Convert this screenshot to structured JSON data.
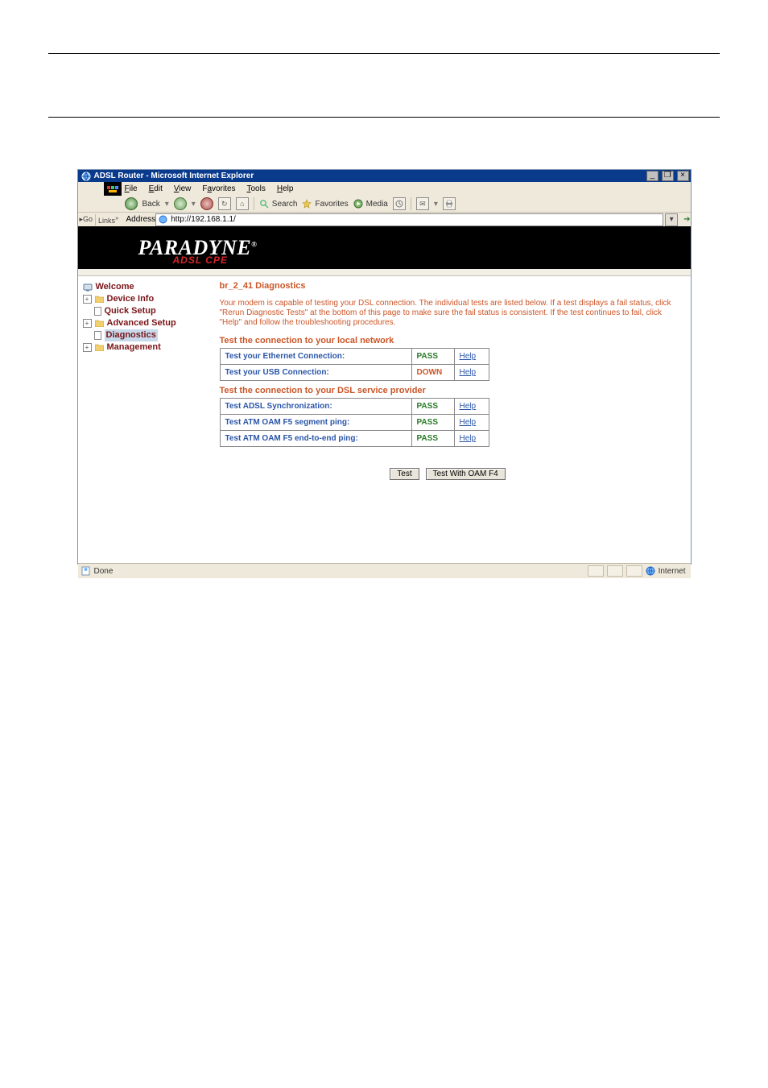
{
  "window": {
    "title": "ADSL Router - Microsoft Internet Explorer",
    "min_label": "_",
    "restore_label": "❐",
    "close_label": "×"
  },
  "menu": {
    "file": "File",
    "edit": "Edit",
    "view": "View",
    "favorites": "Favorites",
    "tools": "Tools",
    "help": "Help"
  },
  "toolbar": {
    "back": "Back",
    "search": "Search",
    "favorites": "Favorites",
    "media": "Media"
  },
  "address": {
    "go": "Go",
    "links": "Links",
    "label": "Address",
    "url": "http://192.168.1.1/"
  },
  "branding": {
    "logo_text": "PARADYNE",
    "reg": "®",
    "sub": "ADSL CPE"
  },
  "nav": {
    "welcome": "Welcome",
    "device_info": "Device Info",
    "quick_setup": "Quick Setup",
    "advanced_setup": "Advanced Setup",
    "diagnostics": "Diagnostics",
    "management": "Management"
  },
  "content": {
    "heading": "br_2_41 Diagnostics",
    "para": "Your modem is capable of testing your DSL connection. The individual tests are listed below. If a test displays a fail status, click \"Rerun Diagnostic Tests\" at the bottom of this page to make sure the fail status is consistent. If the test continues to fail, click \"Help\" and follow the troubleshooting procedures.",
    "section1": "Test the connection to your local network",
    "section2": "Test the connection to your DSL service provider",
    "rows1": [
      {
        "label": "Test your Ethernet Connection:",
        "status": "PASS",
        "statusClass": "pass"
      },
      {
        "label": "Test your USB Connection:",
        "status": "DOWN",
        "statusClass": "down"
      }
    ],
    "rows2": [
      {
        "label": "Test ADSL Synchronization:",
        "status": "PASS",
        "statusClass": "pass"
      },
      {
        "label": "Test ATM OAM F5 segment ping:",
        "status": "PASS",
        "statusClass": "pass"
      },
      {
        "label": "Test ATM OAM F5 end-to-end ping:",
        "status": "PASS",
        "statusClass": "pass"
      }
    ],
    "help": "Help",
    "btn_test": "Test",
    "btn_test_f4": "Test With OAM F4"
  },
  "status": {
    "done": "Done",
    "zone": "Internet"
  }
}
